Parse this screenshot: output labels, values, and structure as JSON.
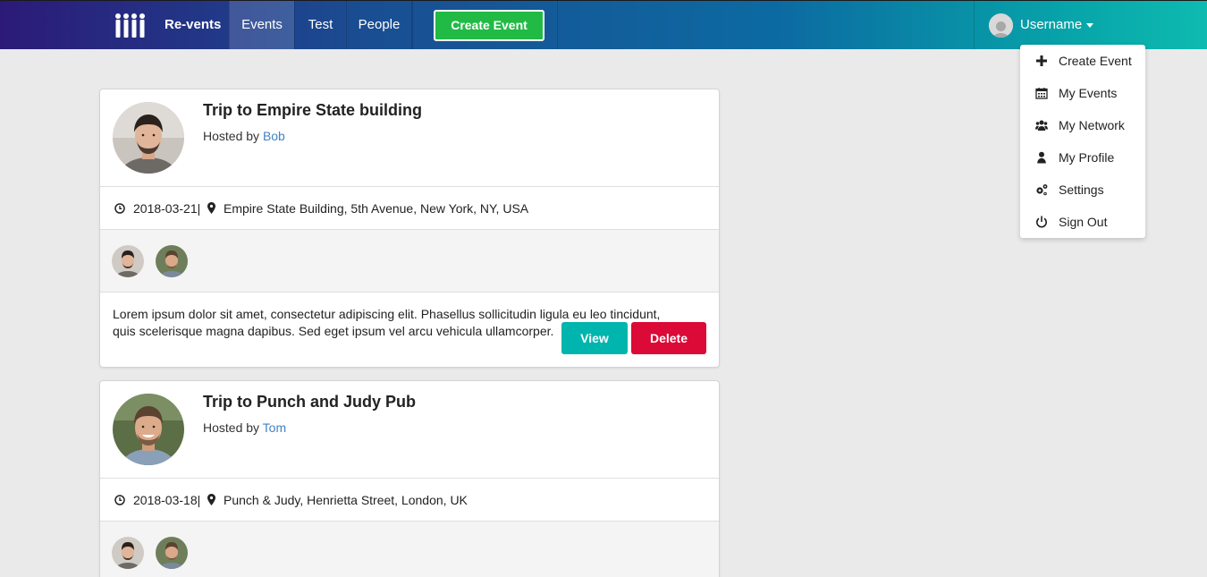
{
  "nav": {
    "brand": "Re-vents",
    "items": [
      "Events",
      "Test",
      "People"
    ],
    "create_button": "Create Event",
    "username": "Username"
  },
  "dropdown": {
    "items": [
      {
        "label": "Create Event",
        "icon": "plus-icon"
      },
      {
        "label": "My Events",
        "icon": "calendar-icon"
      },
      {
        "label": "My Network",
        "icon": "users-icon"
      },
      {
        "label": "My Profile",
        "icon": "user-icon"
      },
      {
        "label": "Settings",
        "icon": "gears-icon"
      },
      {
        "label": "Sign Out",
        "icon": "power-icon"
      }
    ]
  },
  "events": [
    {
      "title": "Trip to Empire State building",
      "hosted_by_prefix": "Hosted by ",
      "host": "Bob",
      "date": "2018-03-21|",
      "location": "Empire State Building, 5th Avenue, New York, NY, USA",
      "description": "Lorem ipsum dolor sit amet, consectetur adipiscing elit. Phasellus sollicitudin ligula eu leo tincidunt, quis scelerisque magna dapibus. Sed eget ipsum vel arcu vehicula ullamcorper.",
      "view_label": "View",
      "delete_label": "Delete"
    },
    {
      "title": "Trip to Punch and Judy Pub",
      "hosted_by_prefix": "Hosted by ",
      "host": "Tom",
      "date": "2018-03-18|",
      "location": "Punch & Judy, Henrietta Street, London, UK"
    }
  ],
  "colors": {
    "create_button": "#21ba45",
    "view_button": "#00b5ad",
    "delete_button": "#db0a36",
    "link": "#4183c4"
  }
}
